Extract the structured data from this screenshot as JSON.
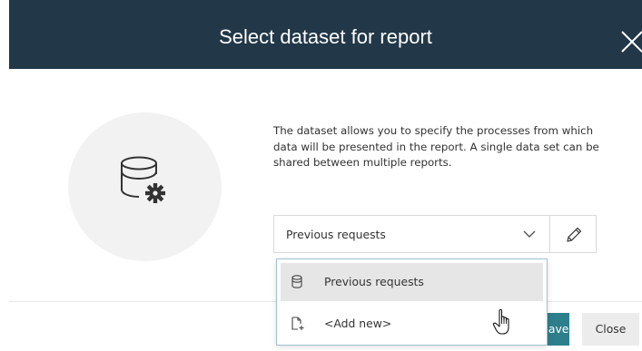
{
  "dialog": {
    "title": "Select dataset for report",
    "description": "The dataset allows you to specify the processes from which data will be presented in the report. A single data set can be shared between multiple reports."
  },
  "dataset_select": {
    "selected_value": "Previous requests",
    "options": [
      {
        "label": "Previous requests",
        "icon": "database-icon"
      },
      {
        "label": "<Add new>",
        "icon": "new-document-icon"
      }
    ]
  },
  "footer": {
    "save_label": "Save",
    "close_label": "Close"
  },
  "colors": {
    "header_bg": "#223849",
    "primary_button": "#2d7f8c",
    "secondary_button": "#ececec",
    "illustration_bg": "#f2f2f2",
    "dropdown_border": "#9cc3cb",
    "hover_item": "#e6e6e6"
  }
}
